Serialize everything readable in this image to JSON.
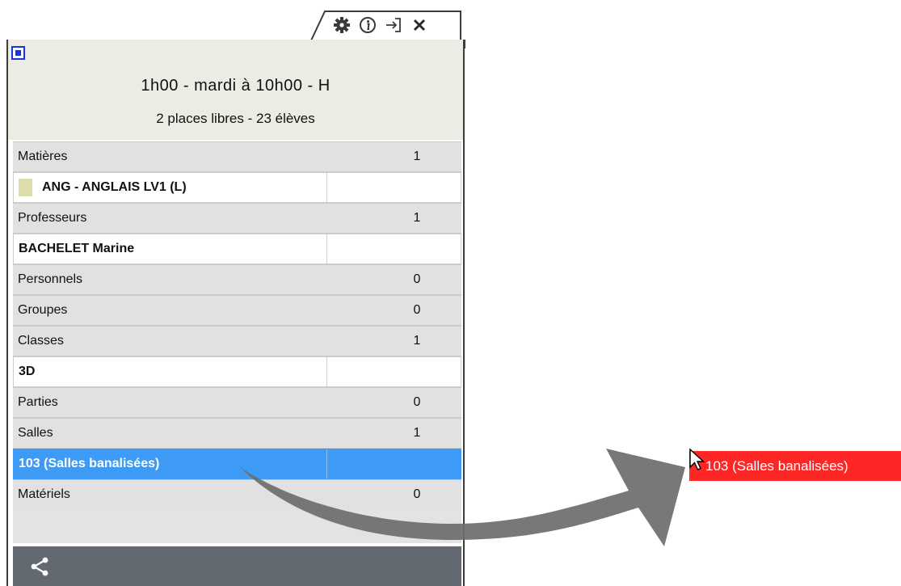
{
  "tab": {
    "icons": [
      "gear-icon",
      "info-icon",
      "exit-icon",
      "close-icon"
    ]
  },
  "header": {
    "line1": "1h00  -  mardi à 10h00  -  H",
    "line2": "2 places libres  -  23 élèves"
  },
  "sections": [
    {
      "label": "Matières",
      "count": "1"
    },
    {
      "label": "Professeurs",
      "count": "1"
    },
    {
      "label": "Personnels",
      "count": "0"
    },
    {
      "label": "Groupes",
      "count": "0"
    },
    {
      "label": "Classes",
      "count": "1"
    },
    {
      "label": "Parties",
      "count": "0"
    },
    {
      "label": "Salles",
      "count": "1"
    },
    {
      "label": "Matériels",
      "count": "0"
    }
  ],
  "items": {
    "matiere": "ANG - ANGLAIS LV1 (L)",
    "professeur": "BACHELET Marine",
    "classe": "3D",
    "salle": "103 (Salles banalisées)"
  },
  "drag": {
    "label": "103 (Salles banalisées)"
  },
  "colors": {
    "accent_selected": "#3d9bf5",
    "drag_badge": "#ff2626",
    "toggle_blue": "#1a32e6",
    "share_bar": "#636971"
  }
}
